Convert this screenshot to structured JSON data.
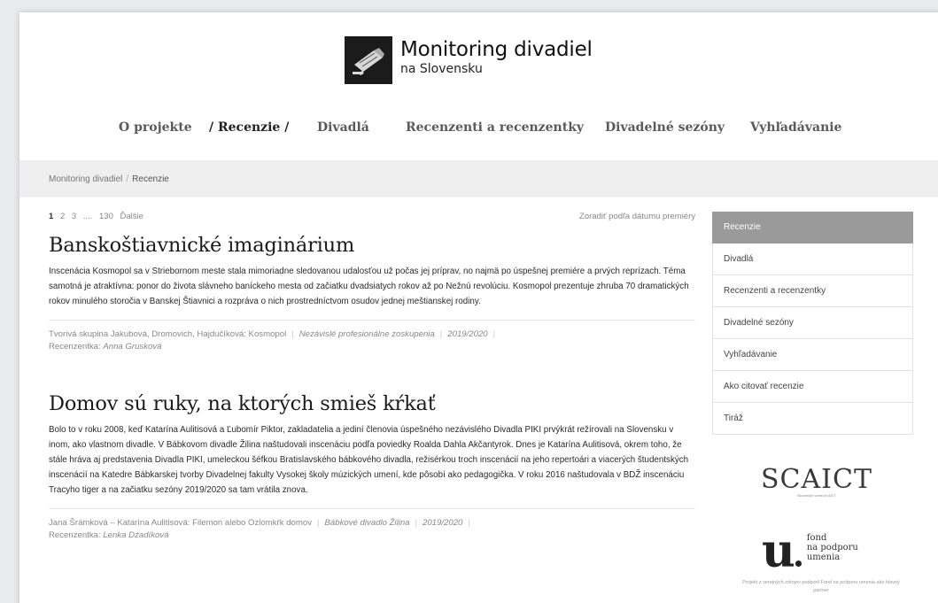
{
  "header": {
    "title": "Monitoring divadiel",
    "subtitle": "na Slovensku"
  },
  "nav": {
    "items": [
      {
        "label": "O projekte"
      },
      {
        "label": "Recenzie"
      },
      {
        "label": "Divadlá"
      },
      {
        "label": "Recenzenti a recenzentky"
      },
      {
        "label": "Divadelné sezóny"
      },
      {
        "label": "Vyhľadávanie"
      }
    ]
  },
  "breadcrumb": {
    "home": "Monitoring divadiel",
    "separator": "/",
    "current": "Recenzie"
  },
  "pager": {
    "pages": [
      "1",
      "2",
      "3",
      "....",
      "130"
    ],
    "next": "Ďalšie",
    "sort": "Zoradiť podľa dátumu premiéry"
  },
  "articles": [
    {
      "title": "Banskoštiavnické imaginárium",
      "text": "Inscenácia Kosmopol sa v Striebornom meste stala mimoriadne sledovanou udalosťou už počas jej príprav, no najmä po úspešnej premiére a prvých reprízach. Téma samotná je atraktívna: ponor do života slávneho baníckeho mesta od začiatku dvadsiatych rokov až po Nežnú revolúciu. Kosmopol prezentuje zhruba 70 dramatických rokov minulého storočia v Banskej Štiavnici a rozpráva o nich prostredníctvom osudov jednej meštianskej rodiny.",
      "production": "Tvorivá skupina Jakubová, Dromovich, Hajdučíková: Kosmopol",
      "theatre": "Nezávislé profesionálne zoskupenia",
      "season": "2019/2020",
      "reviewer_label": "Recenzentka:",
      "reviewer": "Anna Grusková"
    },
    {
      "title": "Domov sú ruky, na ktorých smieš kŕkať",
      "text": "Bolo to v roku 2008, keď Katarína Aulitisová a Ľubomír Piktor, zakladatelia a jediní členovia úspešného nezávislého Divadla PIKI prvýkrát režírovali na Slovensku v inom, ako vlastnom divadle. V Bábkovom divadle Žilina naštudovali inscenáciu podľa poviedky Roalda Dahla Akčantyrok. Dnes je Katarína Aulitisová, okrem toho, že stále hráva aj predstavenia Divadla PIKI, umeleckou šéfkou Bratislavského bábkového divadla, režisérkou troch inscenácií na jeho repertoári a viacerých študentských inscenácií na Katedre Bábkarskej tvorby Divadelnej fakulty Vysokej školy múzických umení, kde pôsobí ako pedagogička. V roku 2016 naštudovala v BDŽ inscenáciu Tracyho tiger a na začiatku sezóny 2019/2020 sa tam vrátila znova.",
      "production": "Jana Šrámková – Katarína Aulitisová: Filemon alebo Ozlomkŕk domov",
      "theatre": "Bábkové divadlo Žilina",
      "season": "2019/2020",
      "reviewer_label": "Recenzentka:",
      "reviewer": "Lenka Dzadíková"
    }
  ],
  "sidebar": {
    "items": [
      {
        "label": "Recenzie"
      },
      {
        "label": "Divadlá"
      },
      {
        "label": "Recenzenti a recenzentky"
      },
      {
        "label": "Divadelné sezóny"
      },
      {
        "label": "Vyhľadávanie"
      },
      {
        "label": "Ako citovať recenzie"
      },
      {
        "label": "Tiráž"
      }
    ]
  },
  "sponsors": {
    "scaict": "SCAICT",
    "scaict_sub": "Slovenské centrum AICT",
    "fond_mark": "u",
    "fond_text": [
      "fond",
      "na podporu",
      "umenia"
    ],
    "note": "Projekt z verejných zdrojov podporil Fond na podporu umenia ako hlavný partner"
  },
  "colors": {
    "active_sidebar": "#9a9a9a",
    "breadcrumb_bg": "#efefef",
    "logo_box": "#1b1b1b"
  }
}
